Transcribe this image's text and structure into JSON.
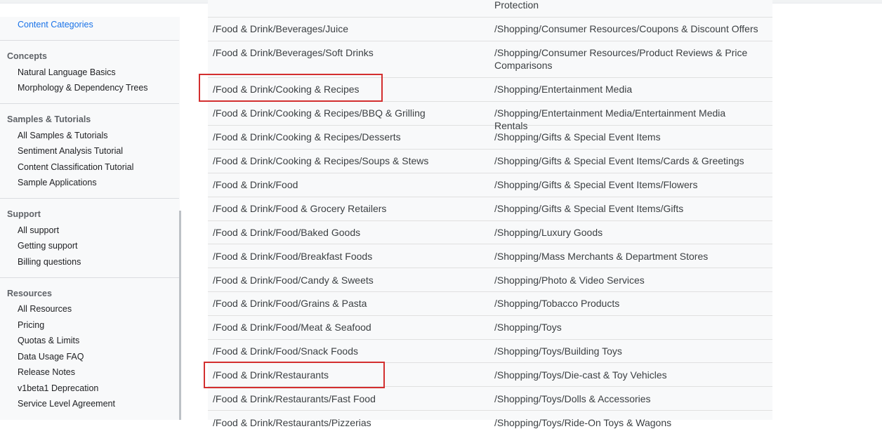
{
  "sidebar": {
    "active_link": "Content Categories",
    "sections": [
      {
        "title": "Concepts",
        "items": [
          "Natural Language Basics",
          "Morphology & Dependency Trees"
        ]
      },
      {
        "title": "Samples & Tutorials",
        "items": [
          "All Samples & Tutorials",
          "Sentiment Analysis Tutorial",
          "Content Classification Tutorial",
          "Sample Applications"
        ]
      },
      {
        "title": "Support",
        "items": [
          "All support",
          "Getting support",
          "Billing questions"
        ]
      },
      {
        "title": "Resources",
        "items": [
          "All Resources",
          "Pricing",
          "Quotas & Limits",
          "Data Usage FAQ",
          "Release Notes",
          "v1beta1 Deprecation",
          "Service Level Agreement"
        ]
      }
    ]
  },
  "table": {
    "partial_top_right": "Protection",
    "rows": [
      [
        "/Food & Drink/Beverages/Juice",
        "/Shopping/Consumer Resources/Coupons & Discount Offers"
      ],
      [
        "/Food & Drink/Beverages/Soft Drinks",
        "/Shopping/Consumer Resources/Product Reviews & Price Comparisons"
      ],
      [
        "/Food & Drink/Cooking & Recipes",
        "/Shopping/Entertainment Media"
      ],
      [
        "/Food & Drink/Cooking & Recipes/BBQ & Grilling",
        "/Shopping/Entertainment Media/Entertainment Media Rentals"
      ],
      [
        "/Food & Drink/Cooking & Recipes/Desserts",
        "/Shopping/Gifts & Special Event Items"
      ],
      [
        "/Food & Drink/Cooking & Recipes/Soups & Stews",
        "/Shopping/Gifts & Special Event Items/Cards & Greetings"
      ],
      [
        "/Food & Drink/Food",
        "/Shopping/Gifts & Special Event Items/Flowers"
      ],
      [
        "/Food & Drink/Food & Grocery Retailers",
        "/Shopping/Gifts & Special Event Items/Gifts"
      ],
      [
        "/Food & Drink/Food/Baked Goods",
        "/Shopping/Luxury Goods"
      ],
      [
        "/Food & Drink/Food/Breakfast Foods",
        "/Shopping/Mass Merchants & Department Stores"
      ],
      [
        "/Food & Drink/Food/Candy & Sweets",
        "/Shopping/Photo & Video Services"
      ],
      [
        "/Food & Drink/Food/Grains & Pasta",
        "/Shopping/Tobacco Products"
      ],
      [
        "/Food & Drink/Food/Meat & Seafood",
        "/Shopping/Toys"
      ],
      [
        "/Food & Drink/Food/Snack Foods",
        "/Shopping/Toys/Building Toys"
      ],
      [
        "/Food & Drink/Restaurants",
        "/Shopping/Toys/Die-cast & Toy Vehicles"
      ],
      [
        "/Food & Drink/Restaurants/Fast Food",
        "/Shopping/Toys/Dolls & Accessories"
      ],
      [
        "/Food & Drink/Restaurants/Pizzerias",
        "/Shopping/Toys/Ride-On Toys & Wagons"
      ]
    ],
    "highlighted_rows": [
      2,
      14
    ]
  },
  "colors": {
    "highlight": "#d32f2f",
    "link_active": "#1a73e8"
  }
}
